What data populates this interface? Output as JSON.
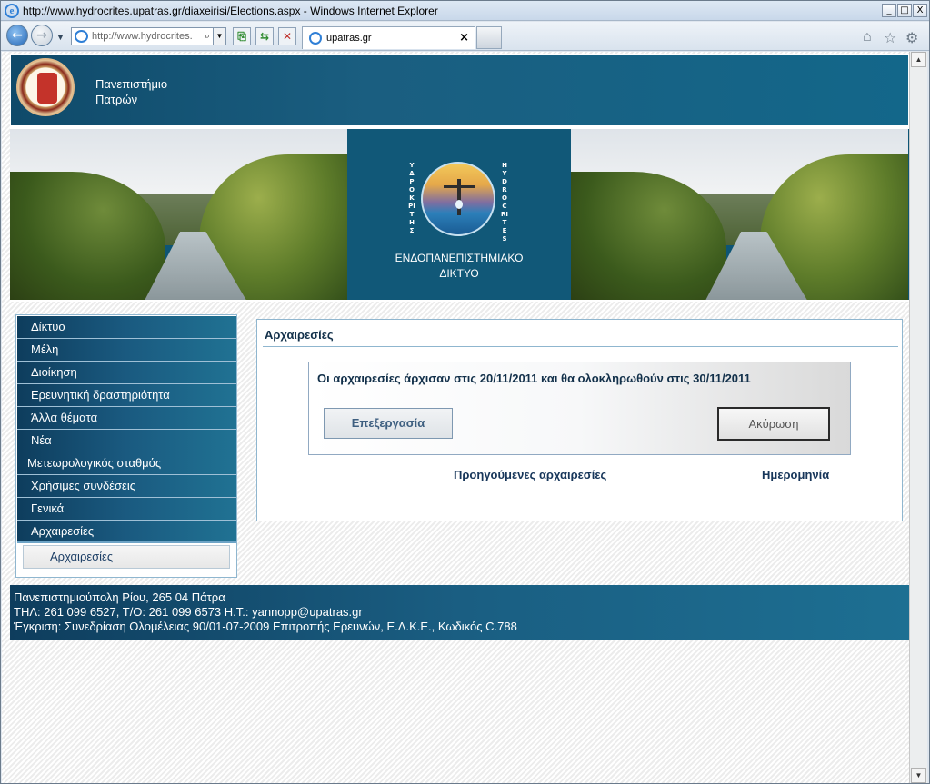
{
  "window": {
    "title": "http://www.hydrocrites.upatras.gr/diaxeirisi/Elections.aspx - Windows Internet Explorer",
    "minimize": "_",
    "maximize": "□",
    "close": "X"
  },
  "browser": {
    "address": "http://www.hydrocrites.",
    "tab_label": "upatras.gr",
    "tab_close": "×"
  },
  "header": {
    "university_line1": "Πανεπιστήμιο",
    "university_line2": "Πατρών"
  },
  "banner": {
    "vertical_left": "ΥΔΡΟΚΡΙΤΗΣ",
    "vertical_right": "HYDROCRITES",
    "title_line1": "ΕΝΔΟΠΑΝΕΠΙΣΤΗΜΙΑΚΟ",
    "title_line2": "ΔΙΚΤΥΟ"
  },
  "sidebar": {
    "items": [
      {
        "label": "Δίκτυο"
      },
      {
        "label": "Μέλη"
      },
      {
        "label": "Διοίκηση"
      },
      {
        "label": "Ερευνητική δραστηριότητα"
      },
      {
        "label": "Άλλα θέματα"
      },
      {
        "label": "Νέα"
      },
      {
        "label": "Μετεωρολογικός σταθμός"
      },
      {
        "label": "Χρήσιμες συνδέσεις"
      },
      {
        "label": "Γενικά"
      },
      {
        "label": "Αρχαιρεσίες"
      }
    ],
    "subitem": "Αρχαιρεσίες"
  },
  "main": {
    "title": "Αρχαιρεσίες",
    "message": "Οι αρχαιρεσίες άρχισαν στις 20/11/2011 και θα ολοκληρωθούν στις 30/11/2011",
    "edit_button": "Επεξεργασία",
    "cancel_button": "Ακύρωση",
    "previous_header": "Προηγούμενες αρχαιρεσίες",
    "date_header": "Ημερομηνία"
  },
  "footer": {
    "line1": "Πανεπιστημιούπολη Ρίου, 265 04 Πάτρα",
    "line2": "ΤΗΛ: 261 099 6527, Τ/Ο: 261 099 6573 Η.Τ.:  yannopp@upatras.gr",
    "line3": "Έγκριση: Συνεδρίαση Ολομέλειας 90/01-07-2009 Επιτροπής Ερευνών, Ε.Λ.Κ.Ε., Κωδικός C.788"
  },
  "colors": {
    "header_blue": "#1a5e80",
    "menu_dark": "#0e3d5d",
    "text_navy": "#12304a"
  }
}
